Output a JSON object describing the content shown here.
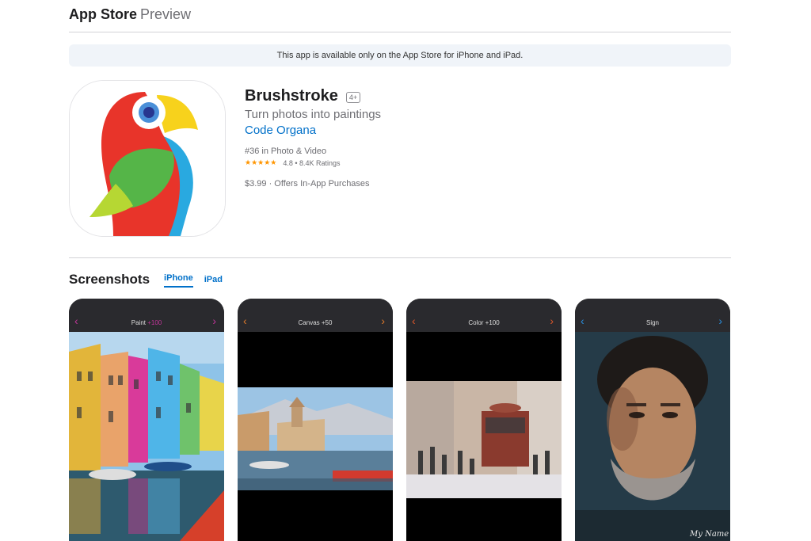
{
  "header": {
    "brand": "App Store",
    "preview": "Preview"
  },
  "banner": {
    "text": "This app is available only on the App Store for iPhone and iPad."
  },
  "app": {
    "title": "Brushstroke",
    "age_rating": "4+",
    "subtitle": "Turn photos into paintings",
    "developer": "Code Organa",
    "rank": "#36 in Photo & Video",
    "stars": "★★★★★",
    "rating": "4.8 • 8.4K Ratings",
    "price": "$3.99 · Offers In-App Purchases",
    "icon": "parrot-app-icon"
  },
  "screenshots": {
    "title": "Screenshots",
    "tabs": [
      {
        "label": "iPhone",
        "active": true
      },
      {
        "label": "iPad",
        "active": false
      }
    ],
    "items": [
      {
        "label": "Paint",
        "label_extra": "+100",
        "chev_color": "#c2359a",
        "image": "colorful-houses-canal"
      },
      {
        "label": "Canvas +50",
        "label_extra": "",
        "chev_color": "#e07a2a",
        "image": "lake-harbor-town"
      },
      {
        "label": "Color +100",
        "label_extra": "",
        "chev_color": "#e0582a",
        "image": "street-tram-crowd"
      },
      {
        "label": "Sign",
        "label_extra": "",
        "chev_color": "#2a8fe0",
        "image": "bearded-man-portrait",
        "signature": "My Name"
      }
    ]
  },
  "colors": {
    "accent": "#0070c9",
    "star": "#ff9500",
    "banner_bg": "#f0f4f9"
  }
}
